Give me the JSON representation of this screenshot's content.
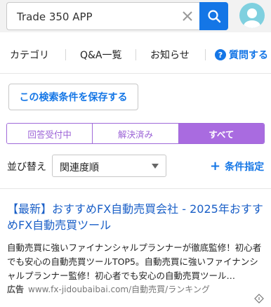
{
  "search": {
    "value": "Trade 350 APP",
    "icons": {
      "clear": "close-icon",
      "submit": "search-icon",
      "avatar": "user-avatar-icon"
    },
    "colors": {
      "button": "#1476e6",
      "avatar": "#7fd0df"
    }
  },
  "nav": {
    "category": "カテゴリ",
    "qa_list": "Q&A一覧",
    "news": "お知らせ",
    "ask": "質問する",
    "ask_icon_glyph": "?"
  },
  "save_condition": {
    "label": "この検索条件を保存する"
  },
  "filters": {
    "items": [
      {
        "label": "回答受付中",
        "active": false
      },
      {
        "label": "解決済み",
        "active": false
      },
      {
        "label": "すべて",
        "active": true
      }
    ],
    "accent_color": "#a96be0"
  },
  "sort": {
    "label": "並び替え",
    "selected": "関連度順",
    "condition_link": "条件指定",
    "condition_icon": "plus-icon"
  },
  "ad": {
    "title": "【最新】おすすめFX自動売買会社 - 2025年おすすめFX自動売買ツール",
    "description": "自動売買に強いファイナンシャルプランナーが徹底監修！初心者でも安心の自動売買ツールTOP5。自動売買に強いファイナンシャルプランナー監修！初心者でも安心の自動売買ツール…",
    "label": "広告",
    "url": "www.fx-jidoubaibai.com/自動売買/ランキング",
    "info_icon": "ad-info-icon"
  }
}
